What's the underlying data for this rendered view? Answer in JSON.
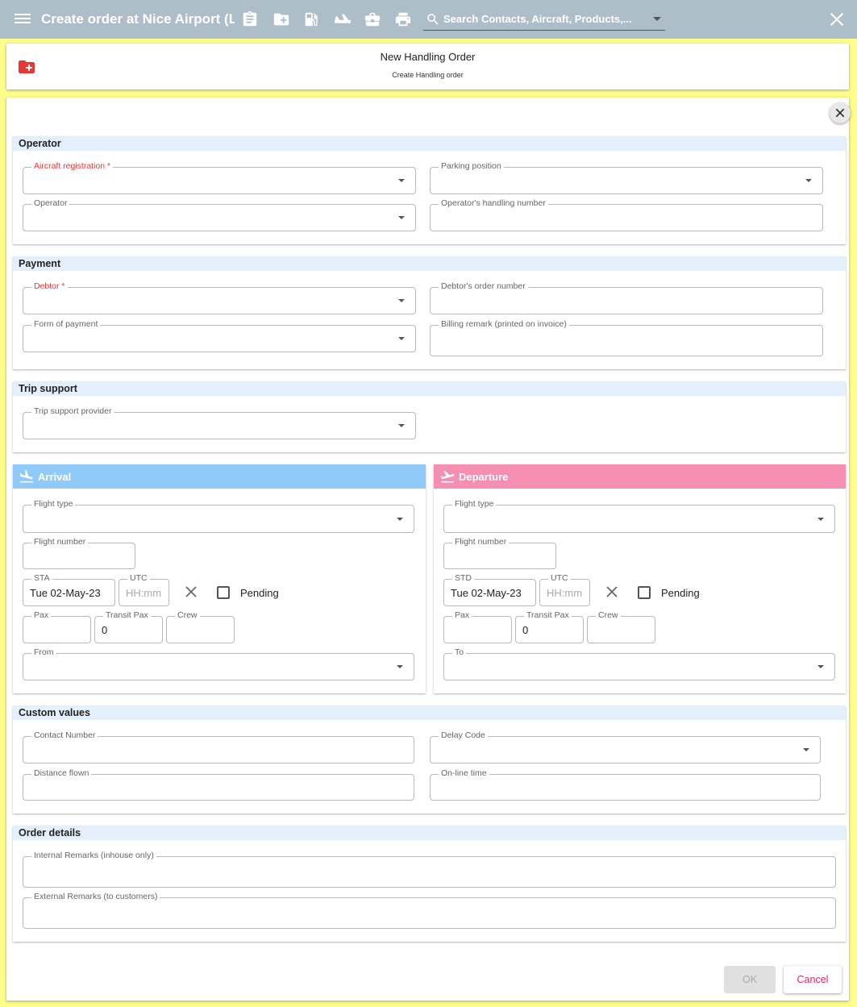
{
  "appbar": {
    "title": "Create order at Nice Airport (LF...",
    "search_placeholder": "Search Contacts, Aircraft, Products,...",
    "icons": [
      "clipboard-icon",
      "folder-plus-icon",
      "fuel-icon",
      "airplane-icon",
      "briefcase-icon",
      "print-icon"
    ]
  },
  "header": {
    "title": "New Handling Order",
    "subtitle": "Create Handling order"
  },
  "operator": {
    "heading": "Operator",
    "aircraft_registration": "Aircraft registration *",
    "parking_position": "Parking position",
    "operator": "Operator",
    "operators_handling_number": "Operator's handling number"
  },
  "payment": {
    "heading": "Payment",
    "debtor": "Debtor *",
    "debtors_order_number": "Debtor's order number",
    "form_of_payment": "Form of payment",
    "billing_remark": "Billing remark (printed on invoice)"
  },
  "trip_support": {
    "heading": "Trip support",
    "provider": "Trip support provider"
  },
  "arrival": {
    "heading": "Arrival",
    "flight_type": "Flight type",
    "flight_number": "Flight number",
    "time_label": "STA",
    "date_value": "Tue 02-May-23",
    "utc_label": "UTC",
    "utc_placeholder": "HH:mm",
    "pending": "Pending",
    "pax": "Pax",
    "transit_pax": "Transit Pax",
    "transit_pax_value": "0",
    "crew": "Crew",
    "place": "From"
  },
  "departure": {
    "heading": "Departure",
    "flight_type": "Flight type",
    "flight_number": "Flight number",
    "time_label": "STD",
    "date_value": "Tue 02-May-23",
    "utc_label": "UTC",
    "utc_placeholder": "HH:mm",
    "pending": "Pending",
    "pax": "Pax",
    "transit_pax": "Transit Pax",
    "transit_pax_value": "0",
    "crew": "Crew",
    "place": "To"
  },
  "custom_values": {
    "heading": "Custom values",
    "contact_number": "Contact Number",
    "delay_code": "Delay Code",
    "distance_flown": "Distance flown",
    "online_time": "On-line time"
  },
  "order_details": {
    "heading": "Order details",
    "internal_remarks": "Internal Remarks (inhouse only)",
    "external_remarks": "External Remarks (to customers)"
  },
  "buttons": {
    "ok": "OK",
    "cancel": "Cancel"
  },
  "colors": {
    "appbar": "#aebec8",
    "page_background": "#fdfd8c",
    "section_header": "#e3f0fb",
    "arrival": "#90caf9",
    "departure": "#f48fb1",
    "required": "#e53935",
    "cancel": "#e91e63"
  }
}
